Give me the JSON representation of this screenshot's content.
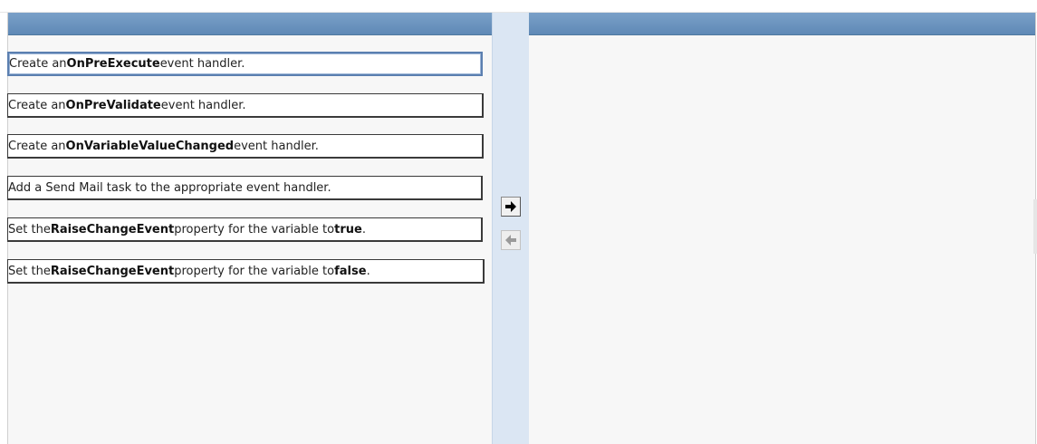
{
  "left_panel": {
    "items": [
      {
        "parts": [
          {
            "text": "Create an ",
            "bold": false
          },
          {
            "text": "OnPreExecute",
            "bold": true
          },
          {
            "text": " event handler.",
            "bold": false
          }
        ],
        "selected": true
      },
      {
        "parts": [
          {
            "text": "Create an ",
            "bold": false
          },
          {
            "text": "OnPreValidate",
            "bold": true
          },
          {
            "text": " event handler.",
            "bold": false
          }
        ],
        "selected": false
      },
      {
        "parts": [
          {
            "text": "Create an ",
            "bold": false
          },
          {
            "text": "OnVariableValueChanged",
            "bold": true
          },
          {
            "text": " event handler.",
            "bold": false
          }
        ],
        "selected": false
      },
      {
        "parts": [
          {
            "text": "Add a Send Mail task to the appropriate event handler.",
            "bold": false
          }
        ],
        "selected": false
      },
      {
        "parts": [
          {
            "text": "Set the ",
            "bold": false
          },
          {
            "text": "RaiseChangeEvent",
            "bold": true
          },
          {
            "text": " property for the variable to ",
            "bold": false
          },
          {
            "text": "true",
            "bold": true
          },
          {
            "text": ".",
            "bold": false
          }
        ],
        "selected": false
      },
      {
        "parts": [
          {
            "text": "Set the ",
            "bold": false
          },
          {
            "text": "RaiseChangeEvent",
            "bold": true
          },
          {
            "text": " property for the variable to ",
            "bold": false
          },
          {
            "text": "false",
            "bold": true
          },
          {
            "text": ".",
            "bold": false
          }
        ],
        "selected": false
      }
    ]
  },
  "controls": {
    "move_right": {
      "icon": "arrow-right-icon",
      "enabled": true
    },
    "move_left": {
      "icon": "arrow-left-icon",
      "enabled": false
    }
  },
  "right_panel": {
    "items": []
  },
  "colors": {
    "header": "#6b93bf",
    "divider": "#dbe6f3",
    "panel_bg": "#f7f7f7",
    "selected_border": "#5b7fb0"
  }
}
